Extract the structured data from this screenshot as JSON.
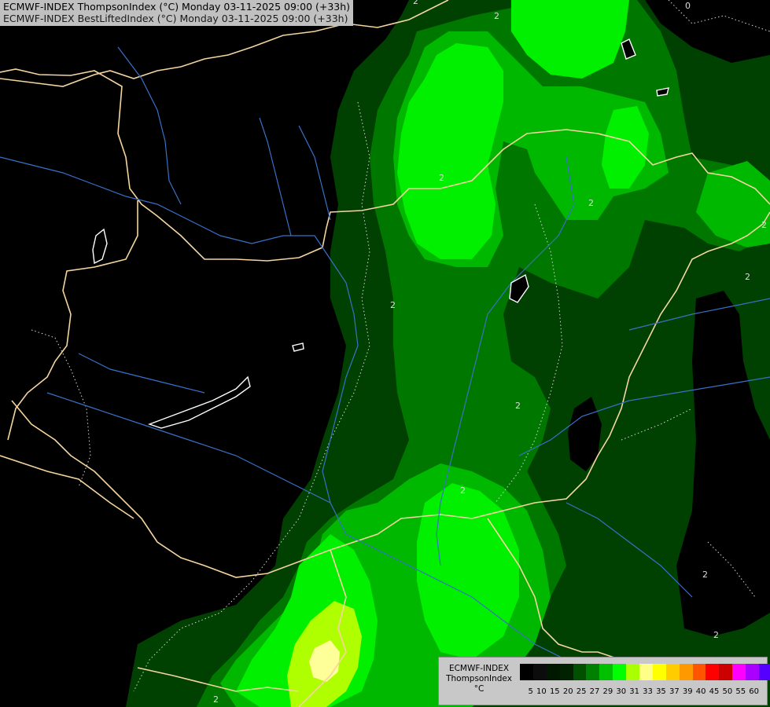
{
  "title": {
    "line1": "ECMWF-INDEX ThompsonIndex (°C) Monday 03-11-2025 09:00 (+33h)",
    "line2": "ECMWF-INDEX BestLiftedIndex (°C) Monday 03-11-2025 09:00 (+33h)"
  },
  "legend": {
    "name_line1": "ECMWF-INDEX",
    "name_line2": "ThompsonIndex",
    "unit": "°C",
    "ticks": [
      "5",
      "10",
      "15",
      "20",
      "25",
      "27",
      "29",
      "30",
      "31",
      "33",
      "35",
      "37",
      "39",
      "40",
      "45",
      "50",
      "55",
      "60"
    ],
    "colors": [
      "#000000",
      "#0c0c0c",
      "#001800",
      "#002200",
      "#005000",
      "#008000",
      "#00c000",
      "#00ff00",
      "#aaff00",
      "#ffff88",
      "#ffff00",
      "#ffcc00",
      "#ff9900",
      "#ff5500",
      "#ff0000",
      "#cc0000",
      "#ff00ff",
      "#aa00ff",
      "#5500ff",
      "#0000ff"
    ]
  },
  "contour_labels": [
    "0",
    "2",
    "2",
    "2",
    "2",
    "2",
    "2",
    "2",
    "2",
    "2",
    "2",
    "2",
    "2"
  ],
  "colors": {
    "background": "#000000",
    "green_dark": "#004000",
    "green_mid": "#007800",
    "green_bright": "#00b800",
    "green_light": "#00f000",
    "lime": "#b0ff00",
    "pale_yellow": "#ffff99",
    "border": "#f5d5a0",
    "river": "#3a70c8",
    "lake": "#ffffff"
  }
}
